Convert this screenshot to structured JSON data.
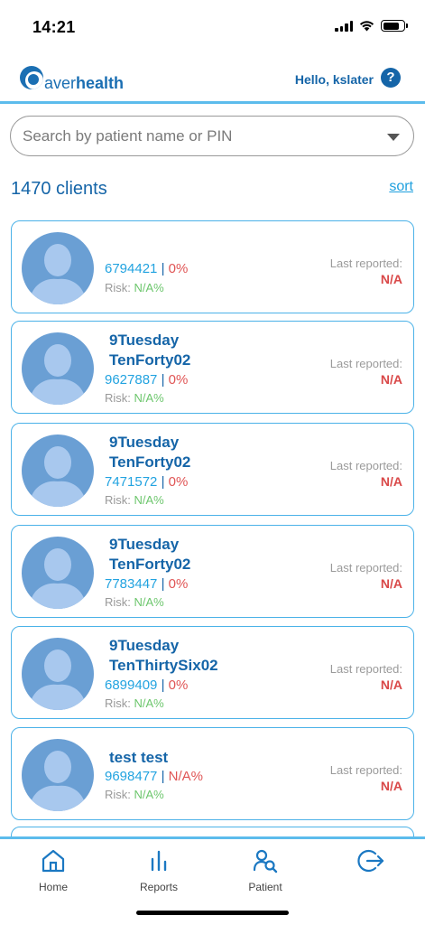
{
  "status_bar": {
    "time": "14:21"
  },
  "header": {
    "logo_prefix": "aver",
    "logo_suffix": "health",
    "greeting": "Hello, kslater",
    "help_glyph": "?"
  },
  "search": {
    "placeholder": "Search by patient name or PIN"
  },
  "list_header": {
    "count_label": "1470 clients",
    "sort_label": "sort"
  },
  "clients": [
    {
      "name": "",
      "pin": "6794421",
      "separator": "|",
      "percent": "0%",
      "risk_label": "Risk:",
      "risk_value": "N/A%",
      "last_reported_label": "Last reported:",
      "last_reported_value": "N/A"
    },
    {
      "name": "9Tuesday\nTenForty02",
      "pin": "9627887",
      "separator": "|",
      "percent": "0%",
      "risk_label": "Risk:",
      "risk_value": "N/A%",
      "last_reported_label": "Last reported:",
      "last_reported_value": "N/A"
    },
    {
      "name": "9Tuesday\nTenForty02",
      "pin": "7471572",
      "separator": "|",
      "percent": "0%",
      "risk_label": "Risk:",
      "risk_value": "N/A%",
      "last_reported_label": "Last reported:",
      "last_reported_value": "N/A"
    },
    {
      "name": "9Tuesday\nTenForty02",
      "pin": "7783447",
      "separator": "|",
      "percent": "0%",
      "risk_label": "Risk:",
      "risk_value": "N/A%",
      "last_reported_label": "Last reported:",
      "last_reported_value": "N/A"
    },
    {
      "name": "9Tuesday\nTenThirtySix02",
      "pin": "6899409",
      "separator": "|",
      "percent": "0%",
      "risk_label": "Risk:",
      "risk_value": "N/A%",
      "last_reported_label": "Last reported:",
      "last_reported_value": "N/A"
    },
    {
      "name": "test test",
      "pin": "9698477",
      "separator": "|",
      "percent": "N/A%",
      "risk_label": "Risk:",
      "risk_value": "N/A%",
      "last_reported_label": "Last reported:",
      "last_reported_value": "N/A"
    }
  ],
  "bottom_nav": {
    "items": [
      {
        "label": "Home",
        "icon": "home-icon"
      },
      {
        "label": "Reports",
        "icon": "bar-chart-icon"
      },
      {
        "label": "Patient",
        "icon": "patient-search-icon"
      },
      {
        "label": "",
        "icon": "logout-icon"
      }
    ]
  },
  "colors": {
    "brand_blue": "#1565a8",
    "accent_cyan": "#5cbcec",
    "pin_blue": "#22a3e0",
    "alert_red": "#d94848",
    "risk_green": "#6cc66c",
    "avatar_blue": "#6a9fd4"
  }
}
